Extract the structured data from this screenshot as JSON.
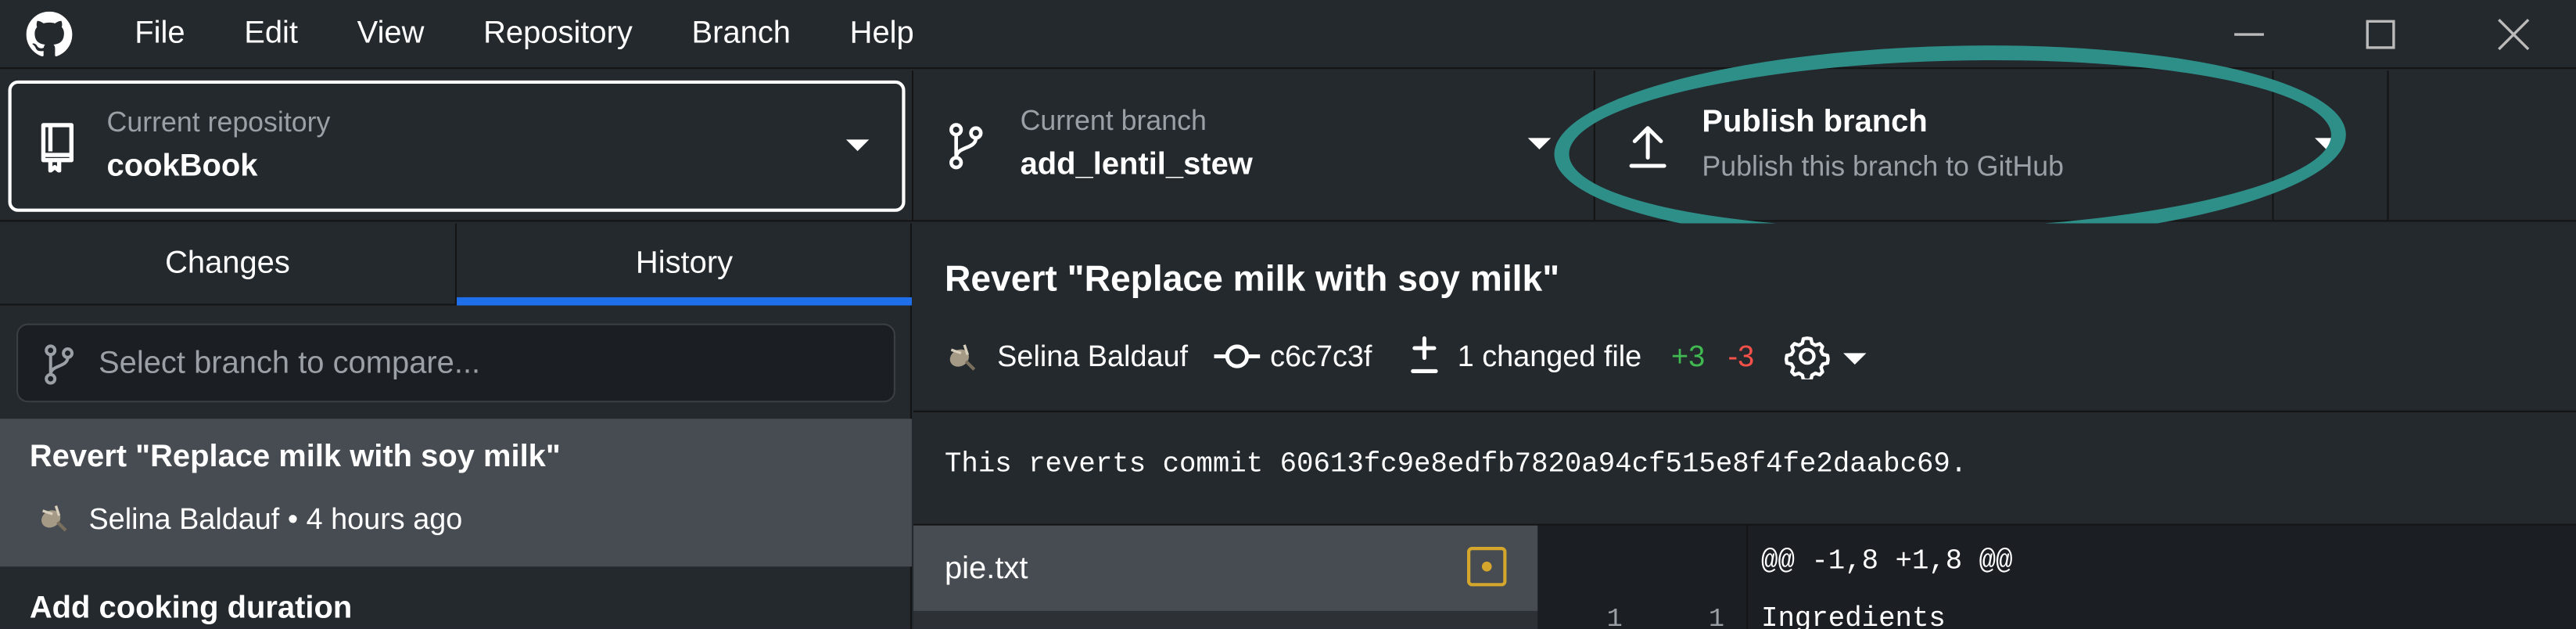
{
  "menu": [
    "File",
    "Edit",
    "View",
    "Repository",
    "Branch",
    "Help"
  ],
  "toolbar": {
    "repo_label": "Current repository",
    "repo_name": "cookBook",
    "branch_label": "Current branch",
    "branch_name": "add_lentil_stew",
    "publish_title": "Publish branch",
    "publish_sub": "Publish this branch to GitHub"
  },
  "tabs": {
    "changes": "Changes",
    "history": "History",
    "active": "History"
  },
  "branch_compare": {
    "placeholder": "Select branch to compare..."
  },
  "commits": [
    {
      "title": "Revert \"Replace milk with soy milk\"",
      "meta": "Selina Baldauf • 4 hours ago",
      "selected": true
    },
    {
      "title": "Add cooking duration"
    }
  ],
  "detail": {
    "title": "Revert \"Replace milk with soy milk\"",
    "author": "Selina Baldauf",
    "sha": "c6c7c3f",
    "changed_files": "1 changed file",
    "additions": "+3",
    "deletions": "-3",
    "description": "This reverts commit 60613fc9e8edfb7820a94cf515e8f4fe2daabc69."
  },
  "files": [
    {
      "name": "pie.txt",
      "status": "modified"
    }
  ],
  "diff": {
    "hunk": "@@ -1,8 +1,8 @@",
    "first_line": {
      "old_no": "1",
      "new_no": "1",
      "text": "Ingredients"
    }
  },
  "colors": {
    "accent": "#1f6feb",
    "highlight": "#2e8f88",
    "add": "#3fb950",
    "del": "#f85149",
    "modified": "#d4a72c"
  }
}
